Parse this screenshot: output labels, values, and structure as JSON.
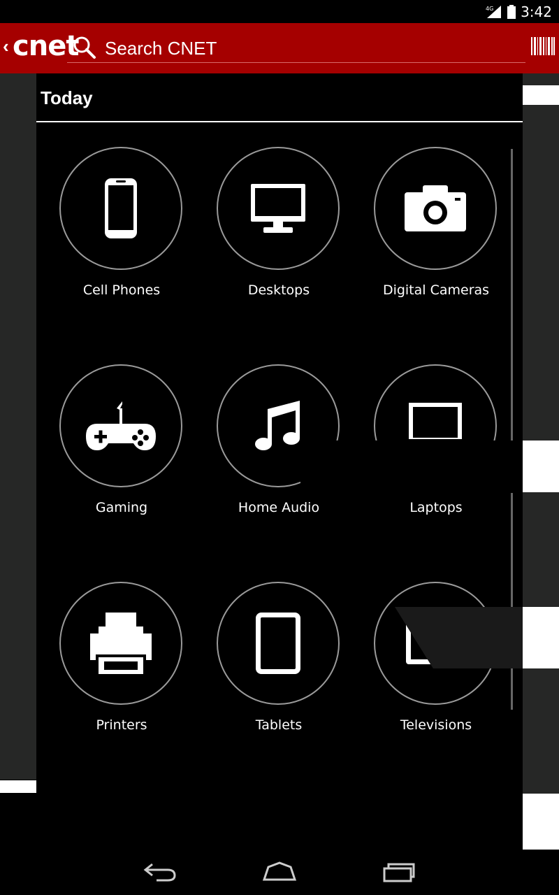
{
  "status_bar": {
    "network": "4G",
    "time": "3:42"
  },
  "app_bar": {
    "logo": "cnet",
    "search_placeholder": "Search CNET",
    "icons": {
      "back": "chevron-left-icon",
      "search": "search-icon",
      "barcode": "barcode-icon"
    }
  },
  "drawer": {
    "title": "Today"
  },
  "categories": [
    {
      "label": "Cell Phones",
      "icon": "cell-phone-icon"
    },
    {
      "label": "Desktops",
      "icon": "desktop-monitor-icon"
    },
    {
      "label": "Digital Cameras",
      "icon": "camera-icon"
    },
    {
      "label": "Gaming",
      "icon": "gamepad-icon"
    },
    {
      "label": "Home Audio",
      "icon": "music-note-icon"
    },
    {
      "label": "Laptops",
      "icon": "laptop-icon"
    },
    {
      "label": "Printers",
      "icon": "printer-icon"
    },
    {
      "label": "Tablets",
      "icon": "tablet-icon"
    },
    {
      "label": "Televisions",
      "icon": "television-icon"
    }
  ],
  "nav_bar": {
    "icons": [
      "back-icon",
      "home-icon",
      "recent-apps-icon"
    ]
  },
  "colors": {
    "brand": "#a50000",
    "background": "#000000",
    "circle_border": "#9a9a9a"
  }
}
